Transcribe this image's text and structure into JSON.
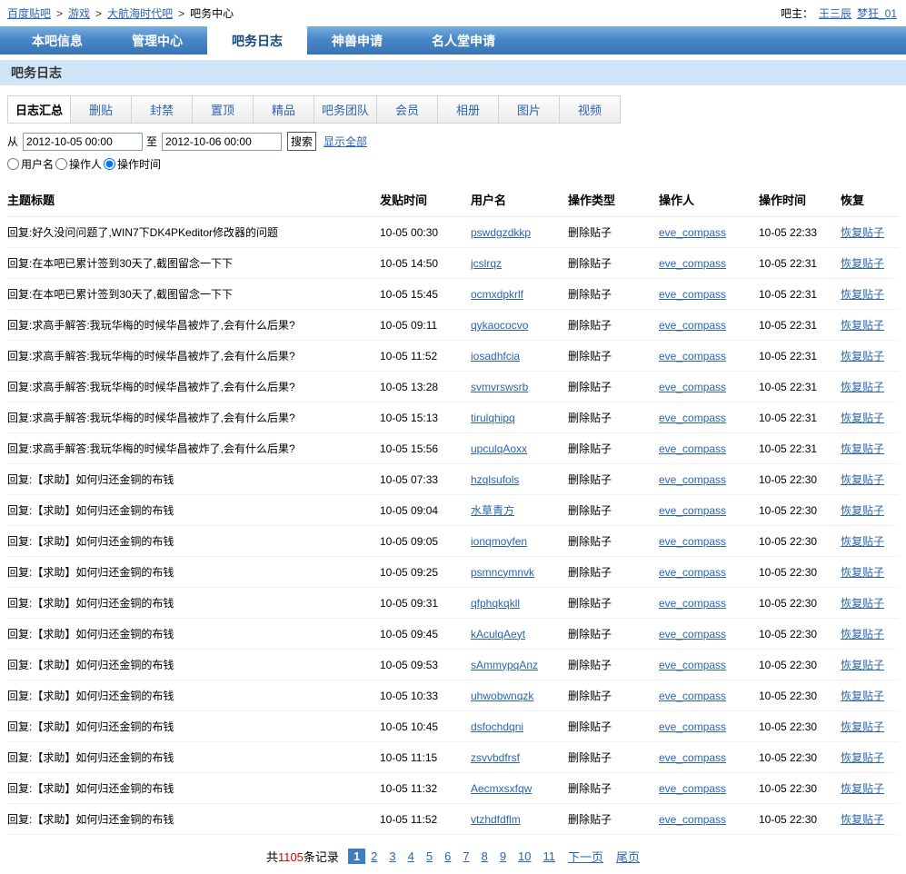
{
  "breadcrumb": {
    "separator": ">",
    "items": [
      {
        "label": "百度贴吧"
      },
      {
        "label": "游戏"
      },
      {
        "label": "大航海时代吧"
      },
      {
        "label": "吧务中心"
      }
    ]
  },
  "header_right": {
    "label": "吧主：",
    "admins": [
      "王三辰",
      "梦狂_01"
    ]
  },
  "nav": {
    "tabs": [
      {
        "label": "本吧信息",
        "active": false
      },
      {
        "label": "管理中心",
        "active": false
      },
      {
        "label": "吧务日志",
        "active": true
      },
      {
        "label": "神兽申请",
        "active": false
      },
      {
        "label": "名人堂申请",
        "active": false
      }
    ]
  },
  "page_title": "吧务日志",
  "subtabs": [
    {
      "label": "日志汇总",
      "active": true
    },
    {
      "label": "删贴",
      "active": false
    },
    {
      "label": "封禁",
      "active": false
    },
    {
      "label": "置顶",
      "active": false
    },
    {
      "label": "精品",
      "active": false
    },
    {
      "label": "吧务团队",
      "active": false
    },
    {
      "label": "会员",
      "active": false
    },
    {
      "label": "相册",
      "active": false
    },
    {
      "label": "图片",
      "active": false
    },
    {
      "label": "视频",
      "active": false
    }
  ],
  "filter": {
    "from_label": "从",
    "from_value": "2012-10-05 00:00",
    "to_label": "至",
    "to_value": "2012-10-06 00:00",
    "search_label": "搜索",
    "show_all_label": "显示全部",
    "radios": [
      {
        "label": "用户名",
        "checked": false
      },
      {
        "label": "操作人",
        "checked": false
      },
      {
        "label": "操作时间",
        "checked": true
      }
    ]
  },
  "table": {
    "columns": [
      "主题标题",
      "发贴时间",
      "用户名",
      "操作类型",
      "操作人",
      "操作时间",
      "恢复"
    ],
    "rows": [
      {
        "title": "回复:好久没问问题了,WIN7下DK4PKeditor修改器的问题",
        "post_time": "10-05 00:30",
        "username": "pswdgzdkkp",
        "op_type": "删除贴子",
        "operator": "eve_compass",
        "op_time": "10-05 22:33",
        "restore": "恢复贴子"
      },
      {
        "title": "回复:在本吧已累计签到30天了,截图留念一下下",
        "post_time": "10-05 14:50",
        "username": "jcslrqz",
        "op_type": "删除贴子",
        "operator": "eve_compass",
        "op_time": "10-05 22:31",
        "restore": "恢复贴子"
      },
      {
        "title": "回复:在本吧已累计签到30天了,截图留念一下下",
        "post_time": "10-05 15:45",
        "username": "ocmxdpkrlf",
        "op_type": "删除贴子",
        "operator": "eve_compass",
        "op_time": "10-05 22:31",
        "restore": "恢复贴子"
      },
      {
        "title": "回复:求高手解答:我玩华梅的时候华昌被炸了,会有什么后果?",
        "post_time": "10-05 09:11",
        "username": "qykaococvo",
        "op_type": "删除贴子",
        "operator": "eve_compass",
        "op_time": "10-05 22:31",
        "restore": "恢复贴子"
      },
      {
        "title": "回复:求高手解答:我玩华梅的时候华昌被炸了,会有什么后果?",
        "post_time": "10-05 11:52",
        "username": "iosadhfcia",
        "op_type": "删除贴子",
        "operator": "eve_compass",
        "op_time": "10-05 22:31",
        "restore": "恢复贴子"
      },
      {
        "title": "回复:求高手解答:我玩华梅的时候华昌被炸了,会有什么后果?",
        "post_time": "10-05 13:28",
        "username": "svmvrswsrb",
        "op_type": "删除贴子",
        "operator": "eve_compass",
        "op_time": "10-05 22:31",
        "restore": "恢复贴子"
      },
      {
        "title": "回复:求高手解答:我玩华梅的时候华昌被炸了,会有什么后果?",
        "post_time": "10-05 15:13",
        "username": "tirulqhipq",
        "op_type": "删除贴子",
        "operator": "eve_compass",
        "op_time": "10-05 22:31",
        "restore": "恢复贴子"
      },
      {
        "title": "回复:求高手解答:我玩华梅的时候华昌被炸了,会有什么后果?",
        "post_time": "10-05 15:56",
        "username": "upculqAoxx",
        "op_type": "删除贴子",
        "operator": "eve_compass",
        "op_time": "10-05 22:31",
        "restore": "恢复贴子"
      },
      {
        "title": "回复:【求助】如何归还金铜的布钱",
        "post_time": "10-05 07:33",
        "username": "hzqlsufols",
        "op_type": "删除贴子",
        "operator": "eve_compass",
        "op_time": "10-05 22:30",
        "restore": "恢复贴子"
      },
      {
        "title": "回复:【求助】如何归还金铜的布钱",
        "post_time": "10-05 09:04",
        "username": "水草青方",
        "op_type": "删除贴子",
        "operator": "eve_compass",
        "op_time": "10-05 22:30",
        "restore": "恢复贴子"
      },
      {
        "title": "回复:【求助】如何归还金铜的布钱",
        "post_time": "10-05 09:05",
        "username": "ionqmoyfen",
        "op_type": "删除贴子",
        "operator": "eve_compass",
        "op_time": "10-05 22:30",
        "restore": "恢复贴子"
      },
      {
        "title": "回复:【求助】如何归还金铜的布钱",
        "post_time": "10-05 09:25",
        "username": "psmncymnvk",
        "op_type": "删除贴子",
        "operator": "eve_compass",
        "op_time": "10-05 22:30",
        "restore": "恢复贴子"
      },
      {
        "title": "回复:【求助】如何归还金铜的布钱",
        "post_time": "10-05 09:31",
        "username": "qfphqkqkll",
        "op_type": "删除贴子",
        "operator": "eve_compass",
        "op_time": "10-05 22:30",
        "restore": "恢复贴子"
      },
      {
        "title": "回复:【求助】如何归还金铜的布钱",
        "post_time": "10-05 09:45",
        "username": "kAculqAeyt",
        "op_type": "删除贴子",
        "operator": "eve_compass",
        "op_time": "10-05 22:30",
        "restore": "恢复贴子"
      },
      {
        "title": "回复:【求助】如何归还金铜的布钱",
        "post_time": "10-05 09:53",
        "username": "sAmmypqAnz",
        "op_type": "删除贴子",
        "operator": "eve_compass",
        "op_time": "10-05 22:30",
        "restore": "恢复贴子"
      },
      {
        "title": "回复:【求助】如何归还金铜的布钱",
        "post_time": "10-05 10:33",
        "username": "uhwobwnqzk",
        "op_type": "删除贴子",
        "operator": "eve_compass",
        "op_time": "10-05 22:30",
        "restore": "恢复贴子"
      },
      {
        "title": "回复:【求助】如何归还金铜的布钱",
        "post_time": "10-05 10:45",
        "username": "dsfochdqni",
        "op_type": "删除贴子",
        "operator": "eve_compass",
        "op_time": "10-05 22:30",
        "restore": "恢复贴子"
      },
      {
        "title": "回复:【求助】如何归还金铜的布钱",
        "post_time": "10-05 11:15",
        "username": "zsvvbdfrsf",
        "op_type": "删除贴子",
        "operator": "eve_compass",
        "op_time": "10-05 22:30",
        "restore": "恢复贴子"
      },
      {
        "title": "回复:【求助】如何归还金铜的布钱",
        "post_time": "10-05 11:32",
        "username": "Aecmxsxfqw",
        "op_type": "删除贴子",
        "operator": "eve_compass",
        "op_time": "10-05 22:30",
        "restore": "恢复贴子"
      },
      {
        "title": "回复:【求助】如何归还金铜的布钱",
        "post_time": "10-05 11:52",
        "username": "vtzhdfdflm",
        "op_type": "删除贴子",
        "operator": "eve_compass",
        "op_time": "10-05 22:30",
        "restore": "恢复贴子"
      }
    ]
  },
  "pagination": {
    "total_prefix": "共",
    "total_count": "1105",
    "total_suffix": "条记录",
    "current_page": "1",
    "pages": [
      "2",
      "3",
      "4",
      "5",
      "6",
      "7",
      "8",
      "9",
      "10",
      "11"
    ],
    "next_label": "下一页",
    "last_label": "尾页"
  }
}
